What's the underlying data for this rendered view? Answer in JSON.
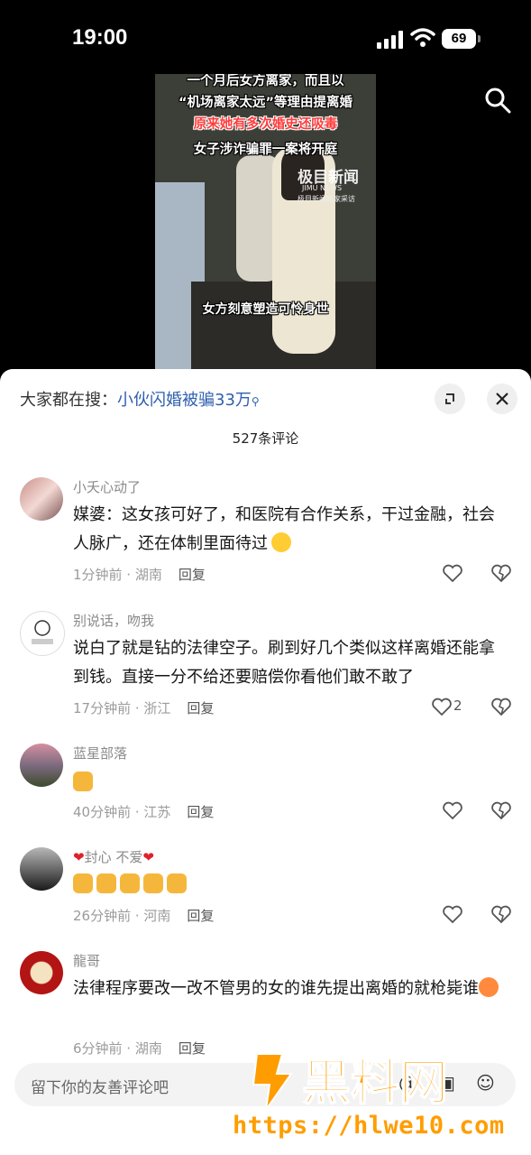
{
  "status": {
    "time": "19:00",
    "battery": "69"
  },
  "video": {
    "captions": [
      "一个月后女方离家，而且以",
      "“机场离家太远”等理由提离婚",
      "原来她有多次婚史还吸毒",
      "女子涉诈骗罪一案将开庭"
    ],
    "bottom_caption": "女方刻意塑造可怜身世",
    "watermark": "极目新闻",
    "watermark_en": "JIMU NEWS",
    "watermark_sub": "极目新闻独家采访"
  },
  "sheet": {
    "search_prefix": "大家都在搜：",
    "search_keyword": "小伙闪婚被骗33万",
    "comment_count": "527条评论",
    "input_placeholder": "留下你的友善评论吧"
  },
  "comments": [
    {
      "name": "小夭心动了",
      "text": "媒婆：这女孩可好了，和医院有合作关系，干过金融，社会人脉广，还在体制里面待过",
      "time": "1分钟前 · 湖南",
      "reply": "回复",
      "likes": ""
    },
    {
      "name": "别说话，吻我",
      "text": "说白了就是钻的法律空子。刷到好几个类似这样离婚还能拿到钱。直接一分不给还要赔偿你看他们敢不敢了",
      "time": "17分钟前 · 浙江",
      "reply": "回复",
      "likes": "2"
    },
    {
      "name": "蓝星部落",
      "text": "",
      "time": "40分钟前 · 江苏",
      "reply": "回复",
      "likes": ""
    },
    {
      "name": "封心 不爱",
      "text": "",
      "time": "26分钟前 · 河南",
      "reply": "回复",
      "likes": ""
    },
    {
      "name": "龍哥",
      "text": "法律程序要改一改不管男的女的谁先提出离婚的就枪毙谁",
      "time": "6分钟前 · 湖南",
      "reply": "回复",
      "likes": ""
    }
  ],
  "overlay": {
    "logo_text": "黑料网",
    "url": "https://hlwe10.com"
  },
  "colors": {
    "link": "#2f5fae",
    "watermark_orange": "#ff9d00"
  }
}
